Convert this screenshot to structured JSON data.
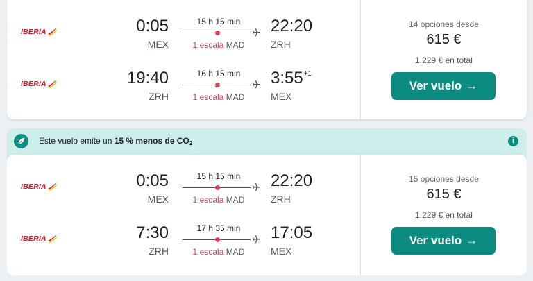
{
  "results": [
    {
      "legs": [
        {
          "airline": "IBERIA",
          "dep_time": "0:05",
          "dep_code": "MEX",
          "duration": "15 h 15 min",
          "stop_count": "1 escala",
          "stop_airport": "MAD",
          "arr_time": "22:20",
          "arr_offset": "",
          "arr_code": "ZRH"
        },
        {
          "airline": "IBERIA",
          "dep_time": "19:40",
          "dep_code": "ZRH",
          "duration": "16 h 15 min",
          "stop_count": "1 escala",
          "stop_airport": "MAD",
          "arr_time": "3:55",
          "arr_offset": "+1",
          "arr_code": "MEX"
        }
      ],
      "options_text": "14 opciones desde",
      "price": "615 €",
      "total": "1.229 € en total",
      "cta_label": "Ver vuelo",
      "cta_arrow": "→"
    },
    {
      "eco_banner": {
        "prefix": "Este vuelo emite un",
        "highlight": "15 % menos de CO",
        "sub": "2",
        "info_symbol": "i"
      },
      "legs": [
        {
          "airline": "IBERIA",
          "dep_time": "0:05",
          "dep_code": "MEX",
          "duration": "15 h 15 min",
          "stop_count": "1 escala",
          "stop_airport": "MAD",
          "arr_time": "22:20",
          "arr_offset": "",
          "arr_code": "ZRH"
        },
        {
          "airline": "IBERIA",
          "dep_time": "7:30",
          "dep_code": "ZRH",
          "duration": "17 h 35 min",
          "stop_count": "1 escala",
          "stop_airport": "MAD",
          "arr_time": "17:05",
          "arr_offset": "",
          "arr_code": "MEX"
        }
      ],
      "options_text": "15 opciones desde",
      "price": "615 €",
      "total": "1.229 € en total",
      "cta_label": "Ver vuelo",
      "cta_arrow": "→"
    }
  ],
  "icons": {
    "airline_logo": "iberia-logo",
    "plane": "plane-icon",
    "eco": "leaf-icon",
    "info": "info-icon"
  },
  "colors": {
    "accent": "#0b8a7f",
    "stop": "#d1435b",
    "eco_bg": "#cdeeea",
    "iberia_red": "#d7192d"
  }
}
